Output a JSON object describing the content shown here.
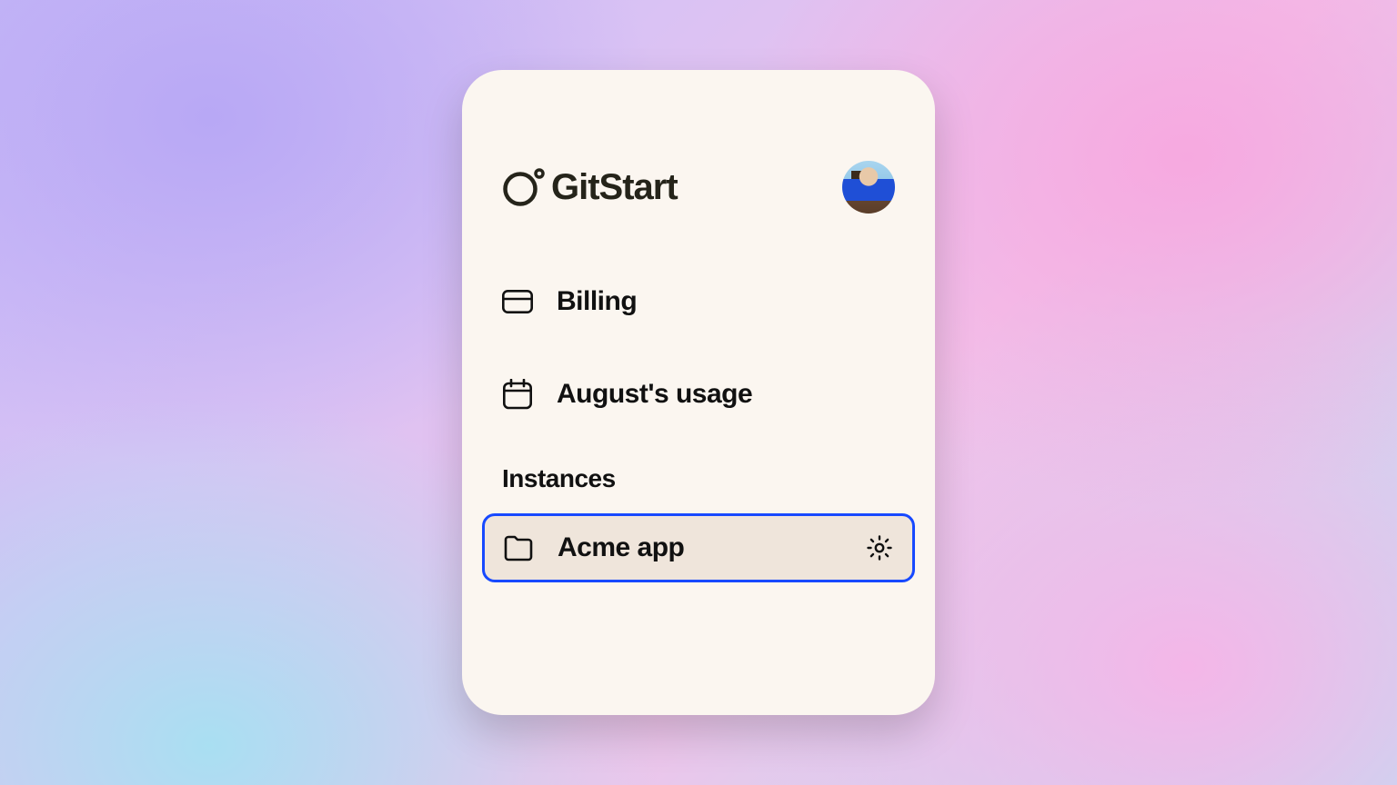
{
  "brand": {
    "name": "GitStart"
  },
  "nav": {
    "billing_label": "Billing",
    "usage_label": "August's usage"
  },
  "instances": {
    "heading": "Instances",
    "items": [
      {
        "label": "Acme app",
        "selected": true
      }
    ]
  }
}
